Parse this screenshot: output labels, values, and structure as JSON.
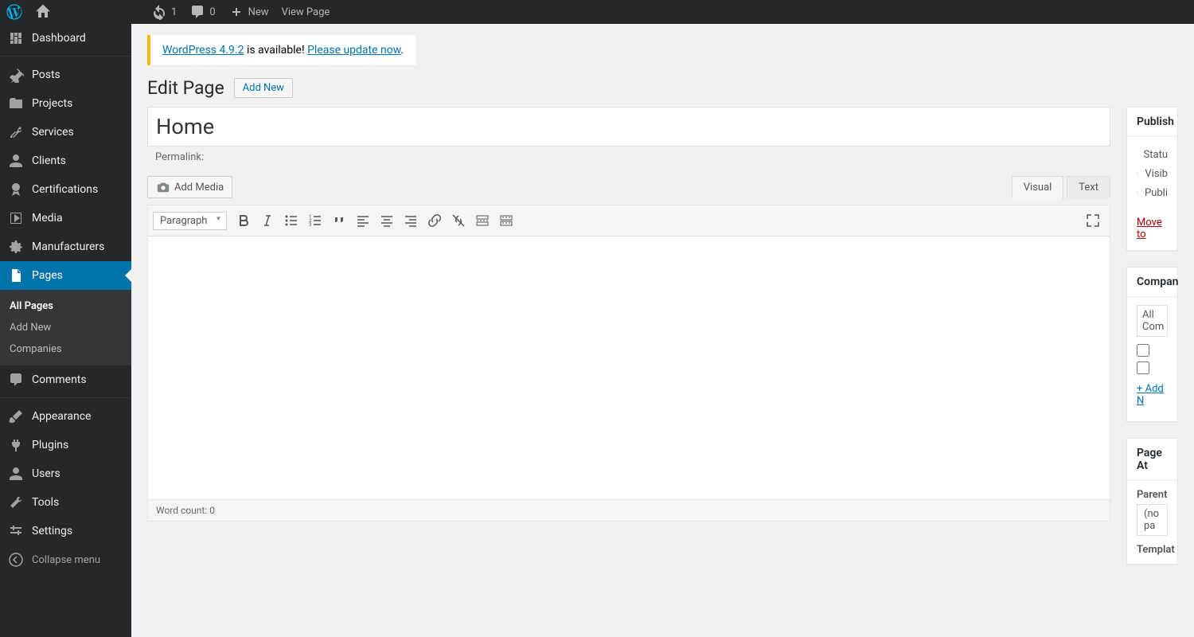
{
  "adminbar": {
    "updates_count": "1",
    "comments_count": "0",
    "new_label": "New",
    "view_page_label": "View Page"
  },
  "sidebar": {
    "items": [
      {
        "label": "Dashboard",
        "icon": "dashboard"
      },
      {
        "label": "Posts",
        "icon": "pin"
      },
      {
        "label": "Projects",
        "icon": "portfolio"
      },
      {
        "label": "Services",
        "icon": "tools"
      },
      {
        "label": "Clients",
        "icon": "user"
      },
      {
        "label": "Certifications",
        "icon": "award"
      },
      {
        "label": "Media",
        "icon": "media"
      },
      {
        "label": "Manufacturers",
        "icon": "gear"
      },
      {
        "label": "Pages",
        "icon": "page",
        "active": true
      },
      {
        "label": "Comments",
        "icon": "comment"
      },
      {
        "label": "Appearance",
        "icon": "brush"
      },
      {
        "label": "Plugins",
        "icon": "plug"
      },
      {
        "label": "Users",
        "icon": "user"
      },
      {
        "label": "Tools",
        "icon": "wrench"
      },
      {
        "label": "Settings",
        "icon": "sliders"
      }
    ],
    "submenu": [
      {
        "label": "All Pages",
        "current": true
      },
      {
        "label": "Add New"
      },
      {
        "label": "Companies"
      }
    ],
    "collapse_label": "Collapse menu"
  },
  "notice": {
    "link1": "WordPress 4.9.2",
    "text1": " is available! ",
    "link2": "Please update now",
    "text2": "."
  },
  "page": {
    "heading": "Edit Page",
    "add_new_btn": "Add New",
    "title_value": "Home",
    "permalink_label": "Permalink:",
    "add_media_btn": "Add Media",
    "tab_visual": "Visual",
    "tab_text": "Text",
    "format_selector": "Paragraph",
    "word_count_label": "Word count: ",
    "word_count_value": "0"
  },
  "publish_box": {
    "title": "Publish",
    "status_label": "Statu",
    "visibility_label": "Visib",
    "published_label": "Publi",
    "trash_link": "Move to "
  },
  "companies_box": {
    "title": "Compan",
    "all_tab": "All Com",
    "add_new_link": "+ Add N"
  },
  "attrs_box": {
    "title": "Page At",
    "parent_label": "Parent",
    "parent_value": "(no pa",
    "template_label": "Templat"
  }
}
